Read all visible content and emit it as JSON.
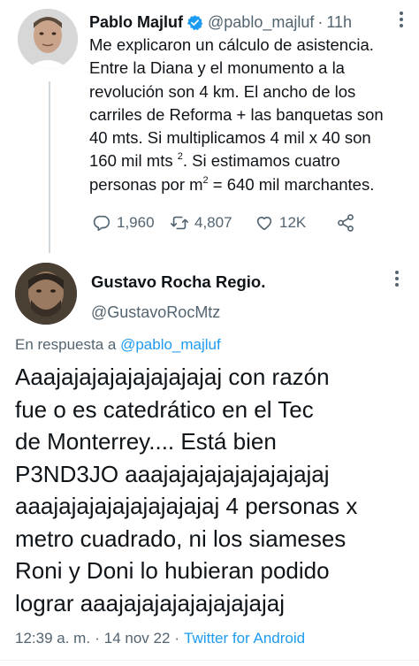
{
  "tweet1": {
    "name": "Pablo Majluf",
    "handle": "@pablo_majluf",
    "separator": "·",
    "time": "11h",
    "lines": [
      "Me explicaron un cálculo de asistencia.",
      "Entre la Diana y el monumento a la",
      "revolución son 4 km.  El ancho de los",
      "carriles de Reforma + las banquetas son",
      "40 mts. Si multiplicamos 4 mil x 40 son"
    ],
    "line6_pre": "160 mil mts ",
    "line6_sup": "2",
    "line6_post": ". Si estimamos cuatro",
    "line7_pre": "personas por m",
    "line7_sup": "2",
    "line7_post": " = 640 mil marchantes.",
    "replies": "1,960",
    "retweets": "4,807",
    "likes": "12K"
  },
  "tweet2": {
    "name": "Gustavo Rocha Regio.",
    "handle": "@GustavoRocMtz",
    "reply_prefix": "En respuesta a ",
    "reply_to": "@pablo_majluf",
    "lines": [
      "Aaajajajajajajajajajaj con razón",
      "fue o es catedrático en el Tec",
      "de Monterrey.... Está bien",
      "P3ND3JO aaajajajajajajajajajaj",
      "aaajajajajajajajajajaj 4 personas x",
      "metro cuadrado, ni los siameses",
      "Roni y Doni lo hubieran podido",
      "lograr aaajajajajajajajajajaj"
    ],
    "time": "12:39 a. m.",
    "date": "14 nov 22",
    "separator": "·",
    "source": "Twitter for Android"
  },
  "colors": {
    "text": "#0f1419",
    "secondary": "#536471",
    "link": "#1d9bf0",
    "verified": "#1d9bf0"
  },
  "icons": [
    "verified-badge-icon",
    "more-icon",
    "reply-icon",
    "retweet-icon",
    "like-icon",
    "share-icon"
  ]
}
